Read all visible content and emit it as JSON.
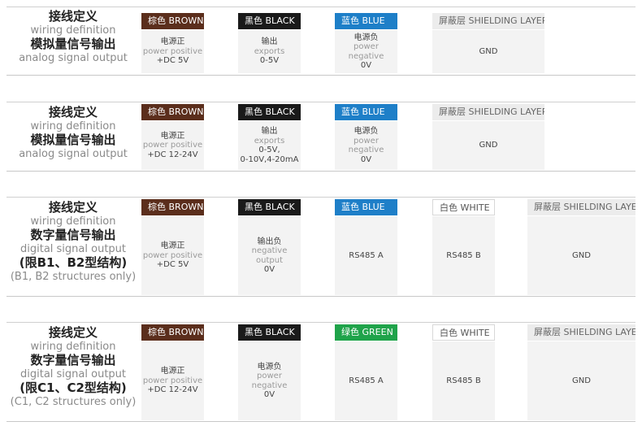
{
  "tables": [
    {
      "label": [
        "接线定义",
        "wiring definition",
        "模拟量信号输出",
        "analog signal output"
      ],
      "headers": [
        {
          "cn": "棕色",
          "en": "BROWN"
        },
        {
          "cn": "黑色",
          "en": "BLACK"
        },
        {
          "cn": "蓝色",
          "en": "BLUE"
        },
        {
          "cn": "屏蔽层",
          "en": "SHIELDING LAYER"
        }
      ],
      "cells": [
        [
          "电源正",
          "power positive",
          "+DC 5V"
        ],
        [
          "输出",
          "exports",
          "0-5V"
        ],
        [
          "电源负",
          "power negative",
          "0V"
        ],
        [
          "GND"
        ]
      ]
    },
    {
      "label": [
        "接线定义",
        "wiring definition",
        "模拟量信号输出",
        "analog signal output"
      ],
      "headers": [
        {
          "cn": "棕色",
          "en": "BROWN"
        },
        {
          "cn": "黑色",
          "en": "BLACK"
        },
        {
          "cn": "蓝色",
          "en": "BLUE"
        },
        {
          "cn": "屏蔽层",
          "en": "SHIELDING LAYER"
        }
      ],
      "cells": [
        [
          "电源正",
          "power positive",
          "+DC 12-24V"
        ],
        [
          "输出",
          "exports",
          "0-5V,",
          "0-10V,4-20mA"
        ],
        [
          "电源负",
          "power negative",
          "0V"
        ],
        [
          "GND"
        ]
      ]
    },
    {
      "label": [
        "接线定义",
        "wiring definition",
        "数字量信号输出",
        "digital signal output",
        "(限B1、B2型结构)",
        "(B1, B2 structures only)"
      ],
      "headers": [
        {
          "cn": "棕色",
          "en": "BROWN"
        },
        {
          "cn": "黑色",
          "en": "BLACK"
        },
        {
          "cn": "蓝色",
          "en": "BLUE"
        },
        {
          "cn": "白色",
          "en": "WHITE"
        },
        {
          "cn": "屏蔽层",
          "en": "SHIELDING LAYER"
        }
      ],
      "cells": [
        [
          "电源正",
          "power positive",
          "+DC 5V"
        ],
        [
          "输出负",
          "negative output",
          "0V"
        ],
        [
          "RS485 A"
        ],
        [
          "RS485 B"
        ],
        [
          "GND"
        ]
      ]
    },
    {
      "label": [
        "接线定义",
        "wiring definition",
        "数字量信号输出",
        "digital signal output",
        "(限C1、C2型结构)",
        "(C1, C2 structures only)"
      ],
      "headers": [
        {
          "cn": "棕色",
          "en": "BROWN"
        },
        {
          "cn": "黑色",
          "en": "BLACK"
        },
        {
          "cn": "绿色",
          "en": "GREEN"
        },
        {
          "cn": "白色",
          "en": "WHITE"
        },
        {
          "cn": "屏蔽层",
          "en": "SHIELDING LAYER"
        }
      ],
      "cells": [
        [
          "电源正",
          "power positive",
          "+DC 12-24V"
        ],
        [
          "电源负",
          "power negative",
          "0V"
        ],
        [
          "RS485 A"
        ],
        [
          "RS485 B"
        ],
        [
          "GND"
        ]
      ]
    }
  ],
  "colors": {
    "brown": "#5b2e1c",
    "black": "#1a1a1a",
    "blue": "#1e7fc8",
    "green": "#1fa34a",
    "shield": "#ececec"
  }
}
